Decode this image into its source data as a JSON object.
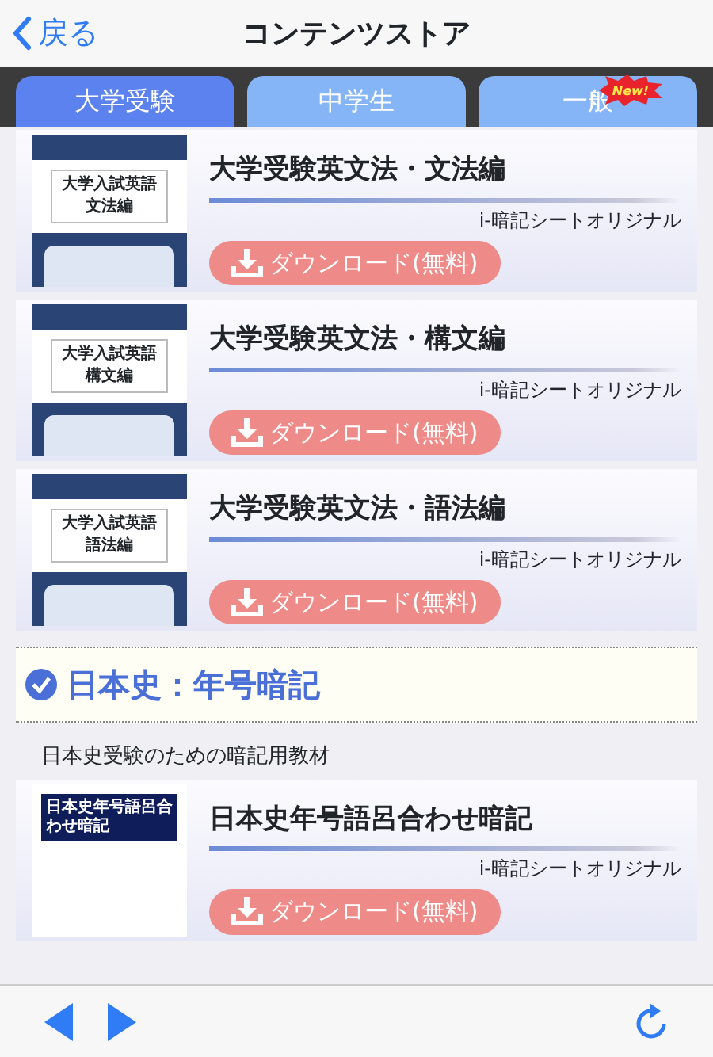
{
  "nav_bar": {
    "back": "戻る",
    "title": "コンテンツストア"
  },
  "tabs": [
    {
      "label": "大学受験",
      "selected": true
    },
    {
      "label": "中学生",
      "selected": false
    },
    {
      "label": "一般",
      "selected": false,
      "badge": "New!"
    }
  ],
  "sections": [
    {
      "items": [
        {
          "title": "大学受験英文法・文法編",
          "publisher": "i-暗記シートオリジナル",
          "button": "ダウンロード(無料)",
          "cover": {
            "kind": "band",
            "lines": [
              "大学入試英語",
              "文法編"
            ]
          }
        },
        {
          "title": "大学受験英文法・構文編",
          "publisher": "i-暗記シートオリジナル",
          "button": "ダウンロード(無料)",
          "cover": {
            "kind": "band",
            "lines": [
              "大学入試英語",
              "構文編"
            ]
          }
        },
        {
          "title": "大学受験英文法・語法編",
          "publisher": "i-暗記シートオリジナル",
          "button": "ダウンロード(無料)",
          "cover": {
            "kind": "band",
            "lines": [
              "大学入試英語",
              "語法編"
            ]
          }
        }
      ]
    },
    {
      "heading": "日本史：年号暗記",
      "description": "日本史受験のための暗記用教材",
      "items": [
        {
          "title": "日本史年号語呂合わせ暗記",
          "publisher": "i-暗記シートオリジナル",
          "button": "ダウンロード(無料)",
          "cover": {
            "kind": "label",
            "lines": [
              "日本史年号語呂合わせ暗記"
            ]
          }
        }
      ]
    }
  ]
}
